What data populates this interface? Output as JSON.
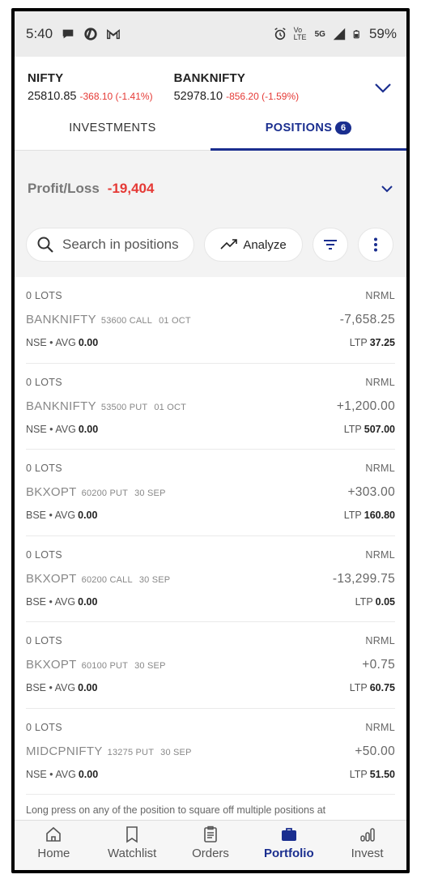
{
  "status_bar": {
    "time": "5:40",
    "net_label": "Vo LTE",
    "signal": "5G",
    "battery": "59%"
  },
  "indices": [
    {
      "name": "NIFTY",
      "value": "25810.85",
      "change": "-368.10 (-1.41%)"
    },
    {
      "name": "BANKNIFTY",
      "value": "52978.10",
      "change": "-856.20 (-1.59%)"
    }
  ],
  "tabs": {
    "investments": "INVESTMENTS",
    "positions": "POSITIONS",
    "positions_count": "6"
  },
  "profit_loss": {
    "label": "Profit/Loss",
    "value": "-19,404"
  },
  "toolbar": {
    "search_placeholder": "Search in positions",
    "analyze_label": "Analyze"
  },
  "positions": [
    {
      "lots": "0 LOTS",
      "product": "NRML",
      "symbol": "BANKNIFTY",
      "strike": "53600 CALL",
      "expiry": "01 OCT",
      "pnl": "-7,658.25",
      "exchange": "NSE • AVG",
      "avg": "0.00",
      "ltp_label": "LTP",
      "ltp": "37.25"
    },
    {
      "lots": "0 LOTS",
      "product": "NRML",
      "symbol": "BANKNIFTY",
      "strike": "53500 PUT",
      "expiry": "01 OCT",
      "pnl": "+1,200.00",
      "exchange": "NSE • AVG",
      "avg": "0.00",
      "ltp_label": "LTP",
      "ltp": "507.00"
    },
    {
      "lots": "0 LOTS",
      "product": "NRML",
      "symbol": "BKXOPT",
      "strike": "60200 PUT",
      "expiry": "30 SEP",
      "pnl": "+303.00",
      "exchange": "BSE • AVG",
      "avg": "0.00",
      "ltp_label": "LTP",
      "ltp": "160.80"
    },
    {
      "lots": "0 LOTS",
      "product": "NRML",
      "symbol": "BKXOPT",
      "strike": "60200 CALL",
      "expiry": "30 SEP",
      "pnl": "-13,299.75",
      "exchange": "BSE • AVG",
      "avg": "0.00",
      "ltp_label": "LTP",
      "ltp": "0.05"
    },
    {
      "lots": "0 LOTS",
      "product": "NRML",
      "symbol": "BKXOPT",
      "strike": "60100 PUT",
      "expiry": "30 SEP",
      "pnl": "+0.75",
      "exchange": "BSE • AVG",
      "avg": "0.00",
      "ltp_label": "LTP",
      "ltp": "60.75"
    },
    {
      "lots": "0 LOTS",
      "product": "NRML",
      "symbol": "MIDCPNIFTY",
      "strike": "13275 PUT",
      "expiry": "30 SEP",
      "pnl": "+50.00",
      "exchange": "NSE • AVG",
      "avg": "0.00",
      "ltp_label": "LTP",
      "ltp": "51.50"
    }
  ],
  "hint": "Long press on any of the position to square off multiple positions at",
  "bottom_nav": [
    {
      "label": "Home",
      "icon": "home-icon"
    },
    {
      "label": "Watchlist",
      "icon": "bookmark-icon"
    },
    {
      "label": "Orders",
      "icon": "clipboard-icon"
    },
    {
      "label": "Portfolio",
      "icon": "briefcase-icon"
    },
    {
      "label": "Invest",
      "icon": "bars-icon"
    }
  ],
  "colors": {
    "accent": "#1a2e8f",
    "loss": "#e53935"
  }
}
